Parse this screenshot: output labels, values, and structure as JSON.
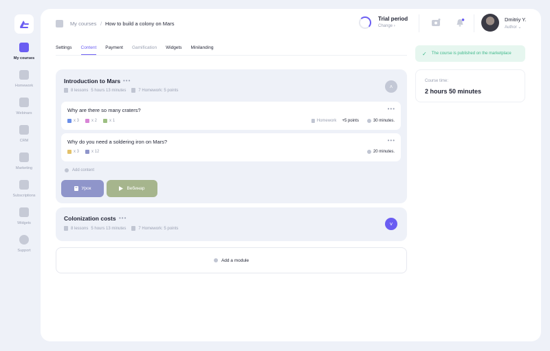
{
  "sidebar": {
    "items": [
      {
        "label": "My courses"
      },
      {
        "label": "Homework"
      },
      {
        "label": "Webinars"
      },
      {
        "label": "CRM"
      },
      {
        "label": "Marketing"
      },
      {
        "label": "Subscriptions"
      },
      {
        "label": "Widgets"
      },
      {
        "label": "Support"
      }
    ]
  },
  "header": {
    "breadcrumb": {
      "parent": "My courses",
      "separator": "/",
      "current": "How to build a colony on Mars"
    },
    "trial": {
      "title": "Trial period",
      "action": "Change"
    },
    "user": {
      "name": "Dmitriy Y.",
      "role": "Author"
    }
  },
  "tabs": [
    {
      "label": "Settings"
    },
    {
      "label": "Content"
    },
    {
      "label": "Payment"
    },
    {
      "label": "Gamification"
    },
    {
      "label": "Widgets"
    },
    {
      "label": "Minilanding"
    }
  ],
  "modules": [
    {
      "title": "Introduction to Mars",
      "dots": "•••",
      "lessons": "8 lessons",
      "duration": "5 hours 13 minutes",
      "homework": "7 Homework: 5 points",
      "items": [
        {
          "title": "Why are there so many craters?",
          "dots": "•••",
          "stats": [
            "x 3",
            "x 2",
            "x 1"
          ],
          "homework_label": "Homework",
          "homework_points": "+5 points",
          "time": "30 minutes."
        },
        {
          "title": "Why do you need a soldering iron on Mars?",
          "dots": "•••",
          "stats": [
            "x 3",
            "x 12"
          ],
          "time": "20 minutes."
        }
      ],
      "add_content": "Add content",
      "buttons": [
        {
          "label": "Урок"
        },
        {
          "label": "Вебинар"
        }
      ]
    },
    {
      "title": "Colonization costs",
      "dots": "•••",
      "lessons": "8 lessons",
      "duration": "5 hours 13 minutes",
      "homework": "7 Homework: 5 points"
    }
  ],
  "add_module": "Add a module",
  "status": {
    "published": "The course is published on the marketplace"
  },
  "course_time": {
    "label": "Course time:",
    "value": "2 hours 50 minutes"
  },
  "colors": {
    "accent": "#6a5df2",
    "lesson_button": "#8f95ca",
    "webinar_button": "#a6b58d",
    "success": "#3fb88b"
  }
}
